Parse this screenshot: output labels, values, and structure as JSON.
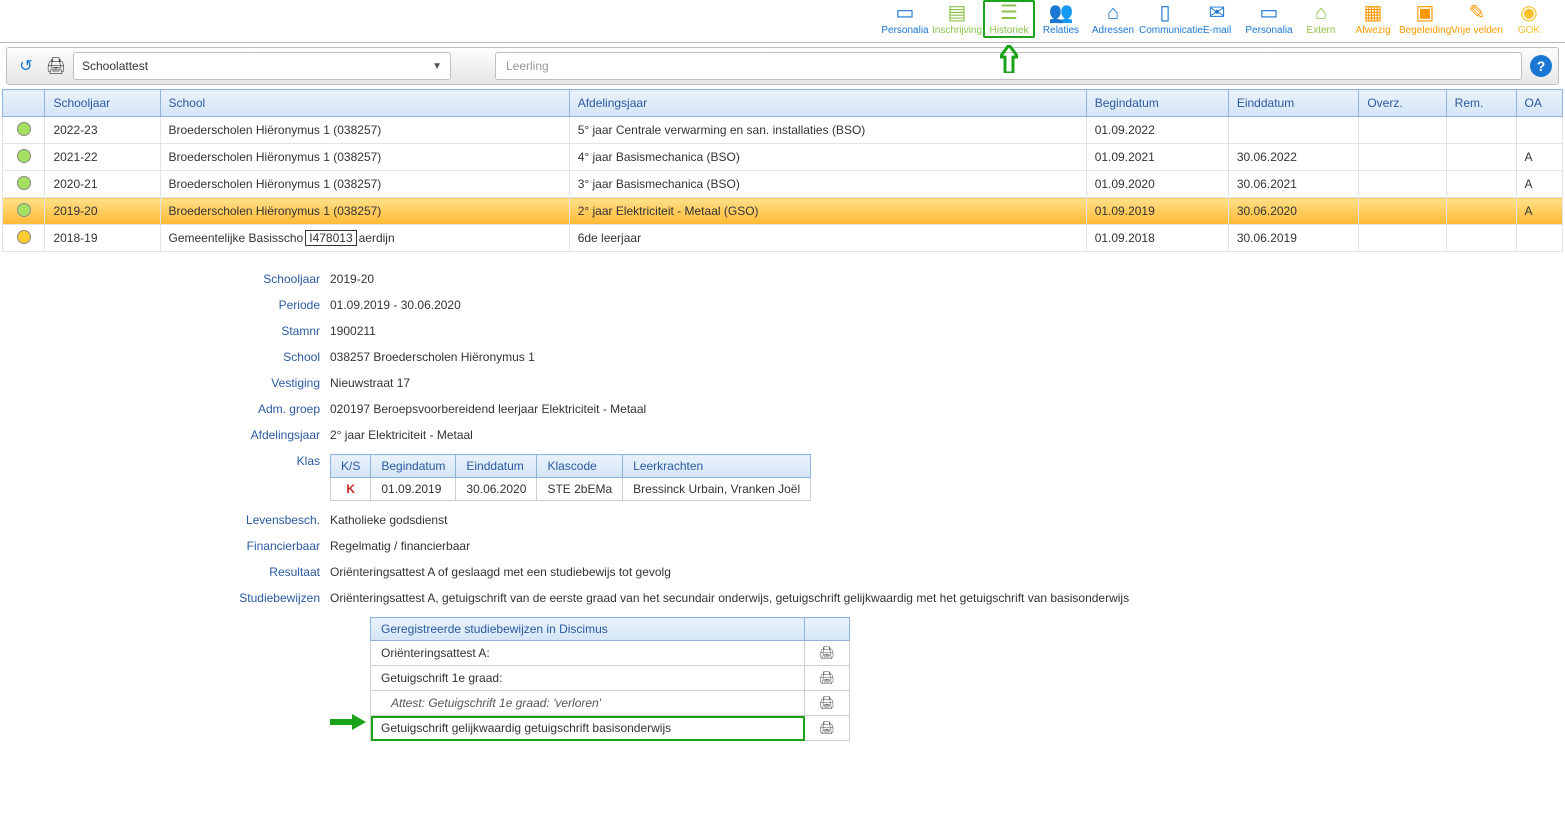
{
  "nav": {
    "items": [
      {
        "label": "Personalia"
      },
      {
        "label": "Inschrijving"
      },
      {
        "label": "Historiek"
      },
      {
        "label": "Relaties"
      },
      {
        "label": "Adressen"
      },
      {
        "label": "Communicatie"
      },
      {
        "label": "E-mail"
      },
      {
        "label": "Personalia"
      },
      {
        "label": "Extern"
      },
      {
        "label": "Afwezig"
      },
      {
        "label": "Begeleiding"
      },
      {
        "label": "Vrije velden"
      },
      {
        "label": "GOK"
      }
    ]
  },
  "toolbar": {
    "select_value": "Schoolattest",
    "search_placeholder": "Leerling",
    "help_label": "?"
  },
  "grid": {
    "headers": {
      "schooljaar": "Schooljaar",
      "school": "School",
      "afdelingsjaar": "Afdelingsjaar",
      "begindatum": "Begindatum",
      "einddatum": "Einddatum",
      "overz": "Overz.",
      "rem": "Rem.",
      "oa": "OA"
    },
    "rows": [
      {
        "status": "green",
        "schooljaar": "2022-23",
        "school": "Broederscholen Hiëronymus 1 (038257)",
        "afdelingsjaar": "5° jaar Centrale verwarming en san. installaties (BSO)",
        "begindatum": "01.09.2022",
        "einddatum": "",
        "overz": "",
        "rem": "",
        "oa": ""
      },
      {
        "status": "green",
        "schooljaar": "2021-22",
        "school": "Broederscholen Hiëronymus 1 (038257)",
        "afdelingsjaar": "4° jaar Basismechanica (BSO)",
        "begindatum": "01.09.2021",
        "einddatum": "30.06.2022",
        "overz": "",
        "rem": "",
        "oa": "A"
      },
      {
        "status": "green",
        "schooljaar": "2020-21",
        "school": "Broederscholen Hiëronymus 1 (038257)",
        "afdelingsjaar": "3° jaar Basismechanica (BSO)",
        "begindatum": "01.09.2020",
        "einddatum": "30.06.2021",
        "overz": "",
        "rem": "",
        "oa": "A"
      },
      {
        "status": "green",
        "schooljaar": "2019-20",
        "school": "Broederscholen Hiëronymus 1 (038257)",
        "afdelingsjaar": "2° jaar Elektriciteit - Metaal (GSO)",
        "begindatum": "01.09.2019",
        "einddatum": "30.06.2020",
        "overz": "",
        "rem": "",
        "oa": "A"
      },
      {
        "status": "yellow",
        "schooljaar": "2018-19",
        "school_pre": "Gemeentelijke Basisscho",
        "school_num": "I478013",
        "school_post": "aerdijn",
        "afdelingsjaar": "6de leerjaar",
        "begindatum": "01.09.2018",
        "einddatum": "30.06.2019",
        "overz": "",
        "rem": "",
        "oa": ""
      }
    ]
  },
  "details": {
    "labels": {
      "schooljaar": "Schooljaar",
      "periode": "Periode",
      "stamnr": "Stamnr",
      "school": "School",
      "vestiging": "Vestiging",
      "admgroep": "Adm. groep",
      "afdelingsjaar": "Afdelingsjaar",
      "klas": "Klas",
      "levensbesch": "Levensbesch.",
      "financierbaar": "Financierbaar",
      "resultaat": "Resultaat",
      "studiebewijzen": "Studiebewijzen"
    },
    "values": {
      "schooljaar": "2019-20",
      "periode": "01.09.2019 - 30.06.2020",
      "stamnr": "1900211",
      "school": "038257 Broederscholen Hiëronymus 1",
      "vestiging": "Nieuwstraat 17",
      "admgroep": "020197  Beroepsvoorbereidend leerjaar Elektriciteit - Metaal",
      "afdelingsjaar": "2° jaar Elektriciteit - Metaal",
      "levensbesch": "Katholieke godsdienst",
      "financierbaar": "Regelmatig / financierbaar",
      "resultaat": "Oriënteringsattest A of geslaagd met een studiebewijs tot gevolg",
      "studiebewijzen": "Oriënteringsattest A, getuigschrift van de eerste graad van het secundair onderwijs, getuigschrift gelijkwaardig met het getuigschrift van basisonderwijs"
    },
    "klas": {
      "headers": {
        "ks": "K/S",
        "begindatum": "Begindatum",
        "einddatum": "Einddatum",
        "klascode": "Klascode",
        "leerkrachten": "Leerkrachten"
      },
      "row": {
        "ks": "K",
        "begindatum": "01.09.2019",
        "einddatum": "30.06.2020",
        "klascode": "STE 2bEMa",
        "leerkrachten": "Bressinck Urbain, Vranken Joël"
      }
    },
    "proofs": {
      "header": "Geregistreerde studiebewijzen in Discimus",
      "rows": [
        {
          "text": "Oriënteringsattest A:"
        },
        {
          "text": "Getuigschrift 1e graad:"
        },
        {
          "text": "Attest: Getuigschrift 1e graad: 'verloren'",
          "italic": true
        },
        {
          "text": "Getuigschrift gelijkwaardig getuigschrift basisonderwijs",
          "boxed": true
        }
      ]
    }
  }
}
